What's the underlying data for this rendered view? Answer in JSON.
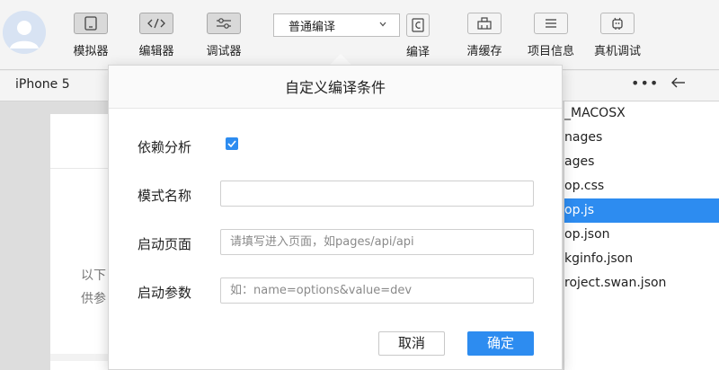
{
  "toolbar": {
    "simulator_label": "模拟器",
    "editor_label": "编辑器",
    "debugger_label": "调试器",
    "compile_mode": "普通编译",
    "compile_label": "编译",
    "clear_cache_label": "清缓存",
    "project_info_label": "项目信息",
    "device_debug_label": "真机调试"
  },
  "device_bar": {
    "device_name": "iPhone 5",
    "more": "•••"
  },
  "simulator": {
    "text_line1": "以下",
    "text_line2": "供参"
  },
  "file_tree": {
    "items": [
      "_MACOSX",
      "nages",
      "ages",
      "op.css",
      "op.js",
      "op.json",
      "kginfo.json",
      "roject.swan.json"
    ],
    "selected_index": 4
  },
  "modal": {
    "title": "自定义编译条件",
    "dependency_label": "依赖分析",
    "dependency_checked": true,
    "mode_name_label": "模式名称",
    "mode_name_value": "",
    "start_page_label": "启动页面",
    "start_page_placeholder": "请填写进入页面，如pages/api/api",
    "start_params_label": "启动参数",
    "start_params_placeholder": "如：name=options&value=dev",
    "cancel_label": "取消",
    "confirm_label": "确定"
  },
  "colors": {
    "accent": "#2d8cf0",
    "toolbar_bg": "#f4f4f4",
    "sim_bg": "#dddddd"
  }
}
